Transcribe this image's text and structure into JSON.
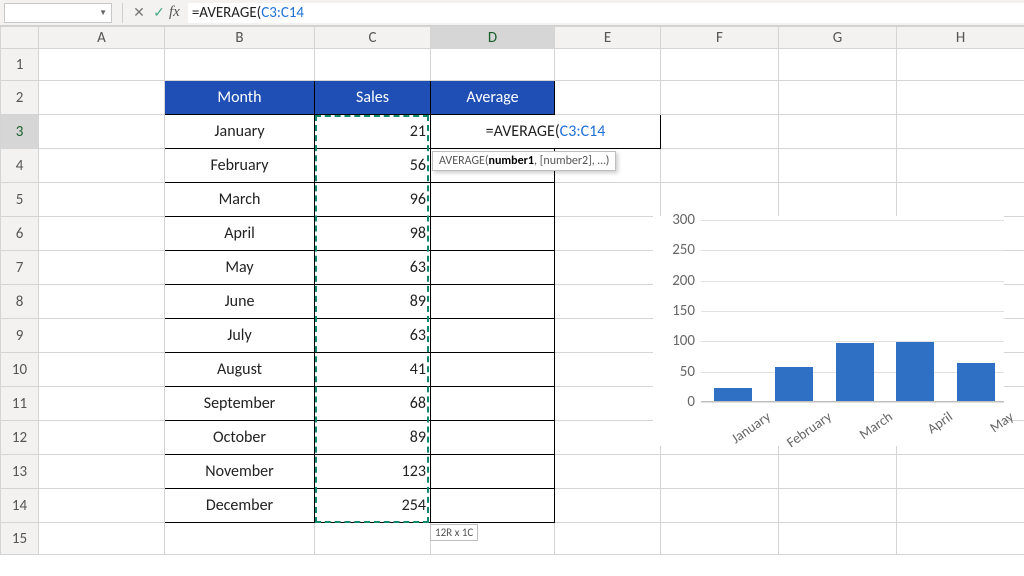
{
  "formula_bar": {
    "namebox": "",
    "cancel_icon": "✕",
    "accept_icon": "✓",
    "fx_label": "fx",
    "formula_prefix": "=AVERAGE(",
    "formula_range": "C3:C14"
  },
  "columns": [
    "A",
    "B",
    "C",
    "D",
    "E",
    "F",
    "G",
    "H"
  ],
  "rows": [
    "1",
    "2",
    "3",
    "4",
    "5",
    "6",
    "7",
    "8",
    "9",
    "10",
    "11",
    "12",
    "13",
    "14",
    "15"
  ],
  "active_col": "D",
  "active_row": "3",
  "table": {
    "headers": {
      "month": "Month",
      "sales": "Sales",
      "average": "Average"
    },
    "rows": [
      {
        "month": "January",
        "sales": "21"
      },
      {
        "month": "February",
        "sales": "56"
      },
      {
        "month": "March",
        "sales": "96"
      },
      {
        "month": "April",
        "sales": "98"
      },
      {
        "month": "May",
        "sales": "63"
      },
      {
        "month": "June",
        "sales": "89"
      },
      {
        "month": "July",
        "sales": "63"
      },
      {
        "month": "August",
        "sales": "41"
      },
      {
        "month": "September",
        "sales": "68"
      },
      {
        "month": "October",
        "sales": "89"
      },
      {
        "month": "November",
        "sales": "123"
      },
      {
        "month": "December",
        "sales": "254"
      }
    ]
  },
  "inline_formula": {
    "prefix": "=AVERAGE(",
    "range": "C3:C14"
  },
  "tooltip": {
    "fn": "AVERAGE(",
    "arg_bold": "number1",
    "rest": ", [number2], …)"
  },
  "selection_size": "12R x 1C",
  "chart_data": {
    "type": "bar",
    "categories": [
      "January",
      "February",
      "March",
      "April",
      "May"
    ],
    "values": [
      21,
      56,
      96,
      98,
      63
    ],
    "yticks": [
      0,
      50,
      100,
      150,
      200,
      250,
      300
    ],
    "ylim": [
      0,
      300
    ],
    "title": "",
    "xlabel": "",
    "ylabel": ""
  },
  "colors": {
    "header_bg": "#1f4fb5",
    "bar_fill": "#2f6fc4",
    "ants": "#12876f",
    "range_ref": "#1e6fd6"
  }
}
